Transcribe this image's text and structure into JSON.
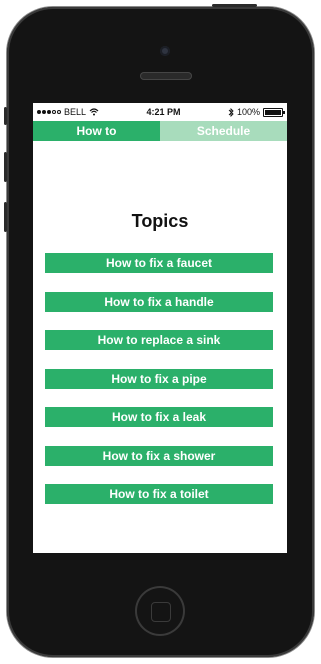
{
  "status_bar": {
    "carrier": "BELL",
    "time": "4:21 PM",
    "battery": "100%",
    "battery_level": 1.0,
    "signal_strength": 3
  },
  "tabs": [
    {
      "label": "How to",
      "active": true
    },
    {
      "label": "Schedule",
      "active": false
    }
  ],
  "main": {
    "title": "Topics",
    "topics": [
      {
        "label": "How to fix a faucet"
      },
      {
        "label": "How to fix a handle"
      },
      {
        "label": "How to replace a sink"
      },
      {
        "label": "How to fix a pipe"
      },
      {
        "label": "How to fix a leak"
      },
      {
        "label": "How to fix a shower"
      },
      {
        "label": "How to fix a toilet"
      }
    ]
  },
  "colors": {
    "accent": "#2bb06a",
    "accent_light": "#a8dcbc",
    "device_body": "#141414"
  },
  "icons": [
    "wifi-icon",
    "bluetooth-icon",
    "battery-icon",
    "camera-icon",
    "home-button"
  ]
}
